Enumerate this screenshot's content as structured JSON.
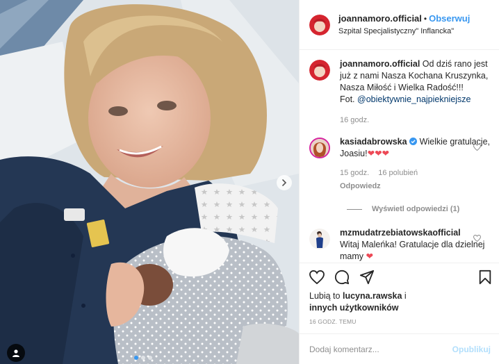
{
  "header": {
    "username": "joannamoro.official",
    "separator": "•",
    "follow_label": "Obserwuj",
    "location": "Szpital Specjalistyczny\" Inflancka\""
  },
  "caption": {
    "username": "joannamoro.official",
    "text": "Od dziś rano jest już z nami Nasza Kochana Kruszynka, Nasza Miłość i Wielka Radość!!!",
    "photo_credit_prefix": "Fot.",
    "photo_credit_mention": "@obiektywnie_najpiekniejsze",
    "time": "16 godz."
  },
  "comments": [
    {
      "username": "kasiadabrowska",
      "verified": true,
      "text": "Wielkie gratulacje, Joasiu!",
      "emoji": "❤❤❤",
      "time": "15 godz.",
      "likes": "16 polubień",
      "reply_label": "Odpowiedz",
      "view_replies": "Wyświetl odpowiedzi (1)"
    },
    {
      "username": "mzmudatrzebiatowskaofficial",
      "text": "Witaj Maleńka! Gratulacje dla dzielnej mamy",
      "emoji": "❤"
    }
  ],
  "likes": {
    "prefix": "Lubią to",
    "user": "lucyna.rawska",
    "suffix": "i",
    "others": "innych użytkowników"
  },
  "timestamp": "16 GODZ. TEMU",
  "add_comment": {
    "placeholder": "Dodaj komentarz...",
    "publish_label": "Opublikuj"
  },
  "carousel": {
    "current": 1,
    "total": 3
  },
  "icons": [
    "heart-icon",
    "comment-icon",
    "share-icon",
    "bookmark-icon",
    "chevron-right-icon",
    "user-tag-icon",
    "verified-icon",
    "small-heart-icon"
  ],
  "colors": {
    "accent": "#3897f0",
    "red": "#ed4956",
    "muted": "#8e8e8e",
    "text": "#262626"
  }
}
